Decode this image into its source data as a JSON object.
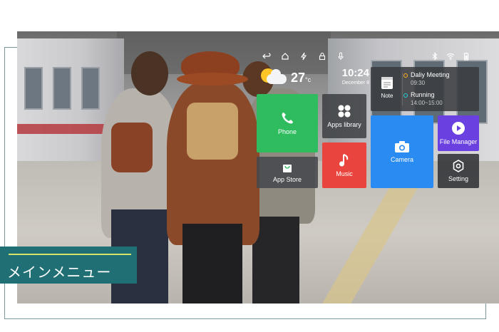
{
  "caption": "メインメニュー",
  "status_bar": {
    "left_icons": [
      "back-icon",
      "home-icon",
      "flashlight-icon",
      "lock-icon",
      "microphone-icon"
    ],
    "right_icons": [
      "bluetooth-icon",
      "wifi-icon",
      "battery-icon"
    ]
  },
  "weather": {
    "temperature": "27",
    "unit": "°c"
  },
  "clock": {
    "time": "10:24",
    "date": "December 8"
  },
  "tiles": {
    "phone": {
      "label": "Phone",
      "color": "#2ebc5f"
    },
    "apps_library": {
      "label": "Apps library"
    },
    "note": {
      "label": "Note"
    },
    "camera": {
      "label": "Camera",
      "color": "#2a8bf2"
    },
    "file_manager": {
      "label": "File Manager",
      "color": "#6a40e0"
    },
    "app_store": {
      "label": "App Store"
    },
    "music": {
      "label": "Music",
      "color": "#e9453e"
    },
    "setting": {
      "label": "Setting"
    }
  },
  "events": [
    {
      "title": "Daliy Meeting",
      "time": "09:30"
    },
    {
      "title": "Running",
      "time": "14:00~15:00"
    }
  ]
}
